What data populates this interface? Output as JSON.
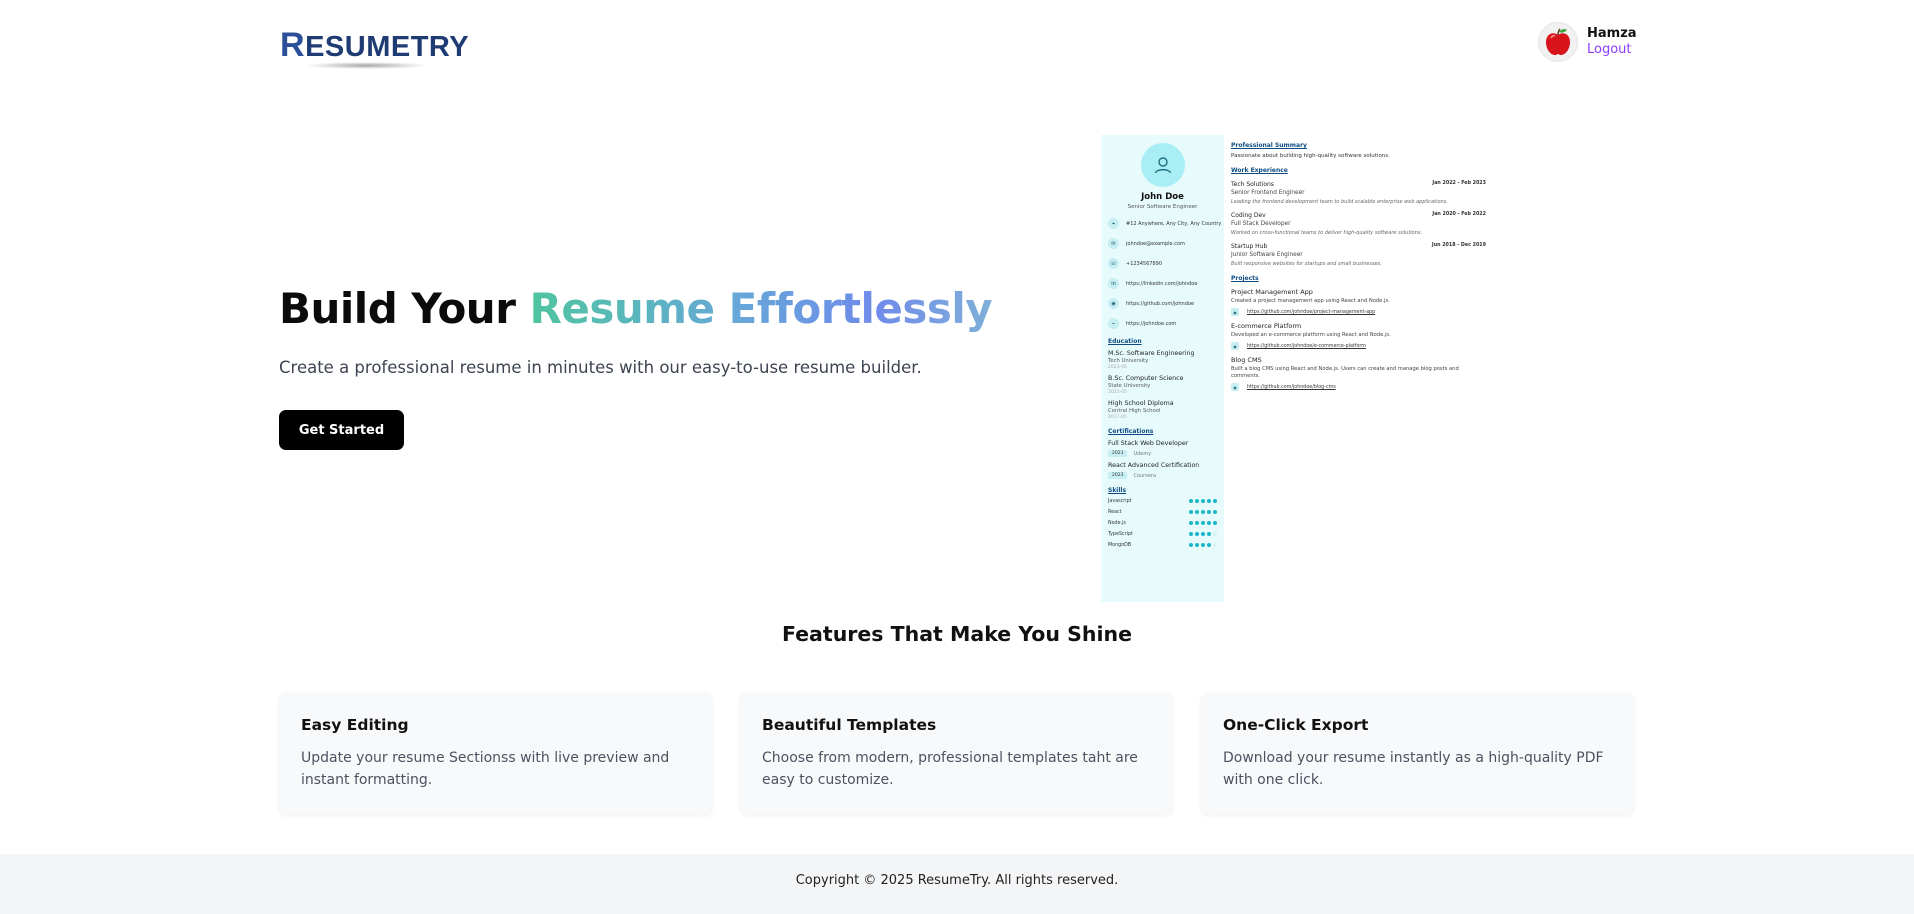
{
  "header": {
    "logo_text": "Resumetry",
    "user": {
      "name": "Hamza",
      "logout_label": "Logout"
    }
  },
  "hero": {
    "title_plain": "Build Your ",
    "title_gradient": "Resume Effortlessly",
    "subtitle": "Create a professional resume in minutes with our easy-to-use resume builder.",
    "cta_label": "Get Started"
  },
  "resume_preview": {
    "name": "John Doe",
    "role": "Senior Software Engineer",
    "contacts": [
      {
        "icon": "location-icon",
        "text": "#12 Anywhere, Any City, Any Country"
      },
      {
        "icon": "mail-icon",
        "text": "johndoe@example.com"
      },
      {
        "icon": "phone-icon",
        "text": "+1234567890"
      },
      {
        "icon": "linkedin-icon",
        "text": "https://linkedin.com/johndoe"
      },
      {
        "icon": "github-icon",
        "text": "https://github.com/johndoe"
      },
      {
        "icon": "website-icon",
        "text": "https://johndoe.com"
      }
    ],
    "education_heading": "Education",
    "education": [
      {
        "degree": "M.Sc. Software Engineering",
        "school": "Tech University",
        "date": "2023-06"
      },
      {
        "degree": "B.Sc. Computer Science",
        "school": "State University",
        "date": "2021-05"
      },
      {
        "degree": "High School Diploma",
        "school": "Central High School",
        "date": "2017-05"
      }
    ],
    "certifications_heading": "Certifications",
    "certifications": [
      {
        "name": "Full Stack Web Developer",
        "year": "2023",
        "issuer": "Udemy"
      },
      {
        "name": "React Advanced Certification",
        "year": "2023",
        "issuer": "Coursera"
      }
    ],
    "skills_heading": "Skills",
    "skills": [
      {
        "name": "Javascript",
        "level": 5
      },
      {
        "name": "React",
        "level": 5
      },
      {
        "name": "Node.js",
        "level": 5
      },
      {
        "name": "TypeScript",
        "level": 4
      },
      {
        "name": "MongoDB",
        "level": 4
      }
    ],
    "summary_heading": "Professional Summary",
    "summary": "Passionate about building high-quality software solutions.",
    "experience_heading": "Work Experience",
    "experience": [
      {
        "company": "Tech Solutions",
        "dates": "Jan 2022 - Feb 2023",
        "title": "Senior Frontend Engineer",
        "description": "Leading the frontend development team to build scalable enterprise web applications."
      },
      {
        "company": "Coding Dev",
        "dates": "Jan 2020 - Feb 2022",
        "title": "Full Stack Developer",
        "description": "Worked on cross-functional teams to deliver high-quality software solutions."
      },
      {
        "company": "Startup Hub",
        "dates": "Jun 2018 - Dec 2019",
        "title": "Junior Software Engineer",
        "description": "Built responsive websites for startups and small businesses."
      }
    ],
    "projects_heading": "Projects",
    "projects": [
      {
        "title": "Project Management App",
        "description": "Created a project management app using React and Node.js.",
        "url": "https://github.com/johndoe/project-management-app"
      },
      {
        "title": "E-commerce Platform",
        "description": "Developed an e-commerce platform using React and Node.js.",
        "url": "https://github.com/johndoe/e-commerce-platform"
      },
      {
        "title": "Blog CMS",
        "description": "Built a blog CMS using React and Node.js. Users can create and manage blog posts and comments.",
        "url": "https://github.com/johndoe/blog-cms"
      }
    ],
    "accent_color": "#19b8c8",
    "sidebar_color": "#e7fbfd"
  },
  "features": {
    "heading": "Features That Make You Shine",
    "cards": [
      {
        "title": "Easy Editing",
        "description": "Update your resume Sectionss with live preview and instant formatting."
      },
      {
        "title": "Beautiful Templates",
        "description": "Choose from modern, professional templates taht are easy to customize."
      },
      {
        "title": "One-Click Export",
        "description": "Download your resume instantly as a high-quality PDF with one click."
      }
    ]
  },
  "footer": {
    "copyright": "Copyright © 2025 ResumeTry. All rights reserved."
  },
  "colors": {
    "logout": "#8b3dff",
    "cta_bg": "#000000",
    "logo": "#1f3b73"
  }
}
